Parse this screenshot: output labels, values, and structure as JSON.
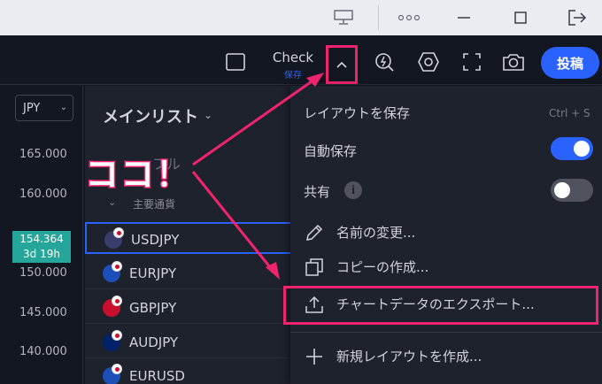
{
  "toolbar": {
    "layout_title": "Check",
    "layout_status": "保存",
    "publish_label": "投稿"
  },
  "axis": {
    "symbol": "JPY",
    "prices": [
      "165.000",
      "160.000",
      "150.000",
      "145.000",
      "140.000"
    ],
    "current_price": "154.364",
    "countdown": "3d 19h"
  },
  "watchlist": {
    "title": "メインリスト",
    "search_placeholder": "フル",
    "group": "主要通貨",
    "rows": [
      {
        "symbol": "USDJPY",
        "selected": true
      },
      {
        "symbol": "EURJPY",
        "selected": false
      },
      {
        "symbol": "GBPJPY",
        "selected": false
      },
      {
        "symbol": "AUDJPY",
        "selected": false
      },
      {
        "symbol": "EURUSD",
        "selected": false
      }
    ]
  },
  "callout": "ココ！",
  "menu": {
    "save_layout": "レイアウトを保存",
    "save_shortcut": "Ctrl + S",
    "autosave": "自動保存",
    "autosave_on": true,
    "share": "共有",
    "share_on": false,
    "rename": "名前の変更...",
    "copy": "コピーの作成...",
    "export": "チャートデータのエクスポート...",
    "new_layout": "新規レイアウトを作成..."
  },
  "colors": {
    "accent": "#2962ff",
    "highlight": "#f0246e",
    "price_badge": "#26a69a"
  }
}
